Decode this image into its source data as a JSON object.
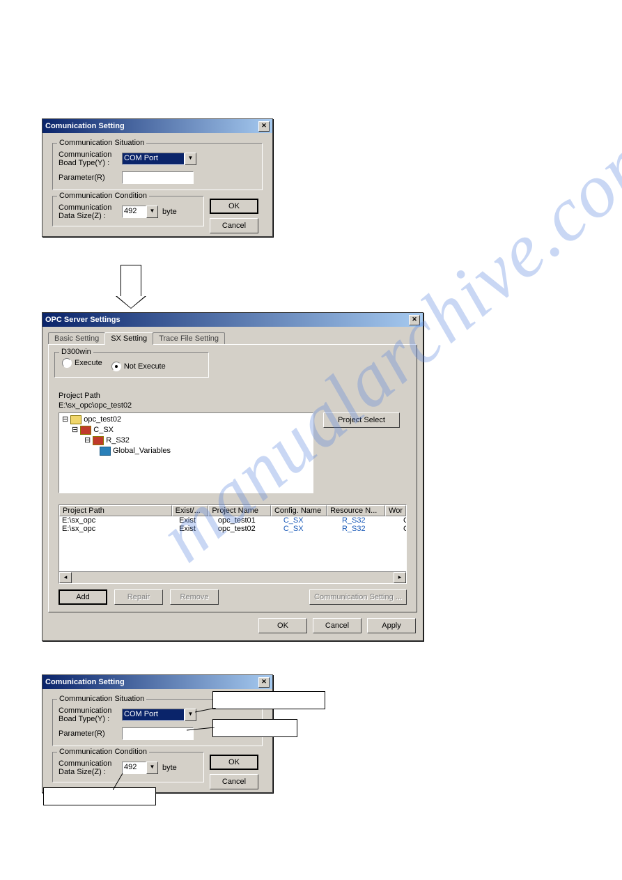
{
  "watermark": "manualarchive.com",
  "dialog1": {
    "title": "Comunication Setting",
    "grpSituation": "Communication Situation",
    "lblBoardType": "Communication\nBoad Type(Y) :",
    "comboBoardType": "COM Port",
    "lblParam": "Parameter(R)",
    "grpCondition": "Communication Condition",
    "lblDataSize": "Communication\nData Size(Z) :",
    "comboDataSize": "492",
    "unit": "byte",
    "ok": "OK",
    "cancel": "Cancel"
  },
  "dialog2": {
    "title": "OPC Server Settings",
    "tabs": [
      "Basic Setting",
      "SX Setting",
      "Trace File Setting"
    ],
    "activeTab": 1,
    "grpD300": "D300win",
    "radioExecute": "Execute",
    "radioNotExecute": "Not Execute",
    "lblProjectPath": "Project Path",
    "pathValue": "E:\\sx_opc\\opc_test02",
    "btnProjectSelect": "Project Select",
    "tree": {
      "n0": "opc_test02",
      "n1": "C_SX",
      "n2": "R_S32",
      "n3": "Global_Variables"
    },
    "cols": {
      "path": "Project Path",
      "exist": "Exist/...",
      "pname": "Project Name",
      "cfg": "Config. Name",
      "res": "Resource N...",
      "wor": "Wor"
    },
    "rows": [
      {
        "path": "E:\\sx_opc",
        "exist": "Exist",
        "pname": "opc_test01",
        "cfg": "C_SX",
        "res": "R_S32",
        "wor": "Glob"
      },
      {
        "path": "E:\\sx_opc",
        "exist": "Exist",
        "pname": "opc_test02",
        "cfg": "C_SX",
        "res": "R_S32",
        "wor": "Glob"
      }
    ],
    "btnAdd": "Add",
    "btnRepair": "Repair",
    "btnRemove": "Remove",
    "btnCommSetting": "Communication Setting ...",
    "ok": "OK",
    "cancel": "Cancel",
    "apply": "Apply"
  },
  "dialog3": {
    "title": "Comunication Setting",
    "grpSituation": "Communication Situation",
    "lblBoardType": "Communication\nBoad Type(Y) :",
    "comboBoardType": "COM Port",
    "lblParam": "Parameter(R)",
    "grpCondition": "Communication Condition",
    "lblDataSize": "Communication\nData Size(Z) :",
    "comboDataSize": "492",
    "unit": "byte",
    "ok": "OK",
    "cancel": "Cancel"
  }
}
